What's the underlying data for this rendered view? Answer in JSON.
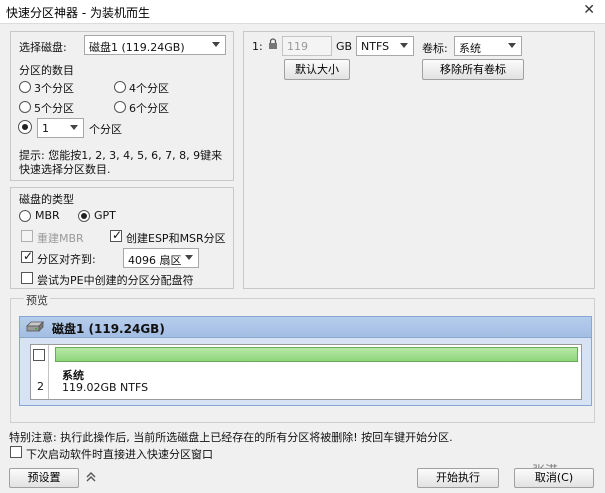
{
  "window": {
    "title": "快速分区神器 - 为装机而生",
    "close_glyph": "✕"
  },
  "left": {
    "select_disk_label": "选择磁盘:",
    "disk_select_value": "磁盘1 (119.24GB)",
    "partition_count_label": "分区的数目",
    "options": [
      "3个分区",
      "4个分区",
      "5个分区",
      "6个分区"
    ],
    "custom_count_value": "1",
    "custom_count_suffix": "个分区",
    "hint_line1": "提示: 您能按1, 2, 3, 4, 5, 6, 7, 8, 9键来",
    "hint_line2": "快速选择分区数目."
  },
  "disk_type": {
    "title": "磁盘的类型",
    "mbr": "MBR",
    "gpt": "GPT",
    "rebuild_mbr": "重建MBR",
    "create_esp": "创建ESP和MSR分区",
    "align_label": "分区对齐到:",
    "align_value": "4096 扇区",
    "assign_letter": "尝试为PE中创建的分区分配盘符"
  },
  "right": {
    "index": "1:",
    "size_value": "119",
    "size_unit": "GB",
    "fs_value": "NTFS",
    "volume_label_label": "卷标:",
    "volume_label_value": "系统",
    "default_size_button": "默认大小",
    "remove_labels_button": "移除所有卷标"
  },
  "preview": {
    "title": "预览",
    "disk_header": "磁盘1 (119.24GB)",
    "partition_index": "2",
    "partition_name": "系统",
    "partition_detail": "119.02GB NTFS"
  },
  "footer": {
    "warning": "特别注意: 执行此操作后, 当前所选磁盘上已经存在的所有分区将被删除! 按回车键开始分区.",
    "auto_open": "下次启动软件时直接进入快速分区窗口",
    "preset_button": "预设置",
    "start_button": "开始执行",
    "cancel_button": "取消(C)",
    "watermark": "张港一"
  }
}
